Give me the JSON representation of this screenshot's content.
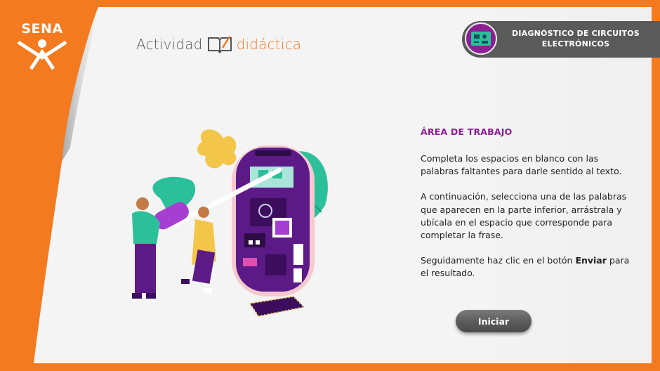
{
  "brand": {
    "logo_text": "SENA"
  },
  "header": {
    "activity_word": "Actividad",
    "didactic_word": "didáctica",
    "badge_title_line1": "DIAGNÓSTICO DE CIRCUITOS",
    "badge_title_line2": "ELECTRÓNICOS"
  },
  "main": {
    "section_title": "ÁREA DE TRABAJO",
    "paragraph1": "Completa los espacios en blanco con las palabras faltantes para darle sentido al texto.",
    "paragraph2": "A continuación, selecciona una de las palabras que aparecen en la parte inferior, arrástrala y ubícala en el espacio que corresponde para completar la frase.",
    "paragraph3_before": "Seguidamente haz clic en el botón ",
    "paragraph3_bold": "Enviar",
    "paragraph3_after": " para el resultado.",
    "start_label": "Iniciar"
  },
  "colors": {
    "orange": "#f47a1f",
    "purple": "#8e1e93",
    "gray_dark": "#5a5a5a",
    "teal": "#2bbf9a"
  },
  "icons": [
    "sena-logo",
    "book-pencil-icon",
    "circuit-board-icon",
    "circuit-illustration"
  ]
}
